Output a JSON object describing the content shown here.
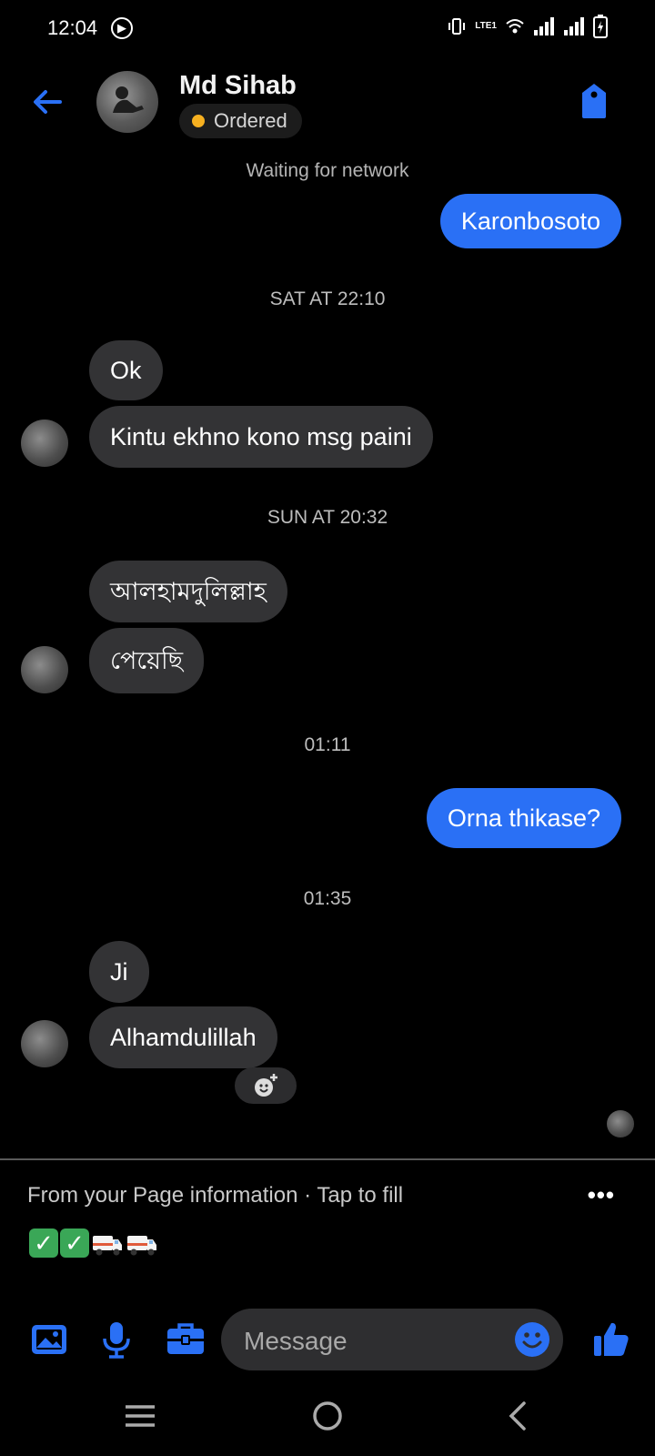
{
  "status_bar": {
    "time": "12:04",
    "network_label": "LTE1"
  },
  "header": {
    "contact_name": "Md Sihab",
    "label_status": "Ordered",
    "label_color": "#f6b020"
  },
  "network_notice": "Waiting for network",
  "messages": [
    {
      "kind": "out",
      "text": "Karonbosoto"
    },
    {
      "kind": "stamp",
      "text": "SAT AT 22:10"
    },
    {
      "kind": "in",
      "text": "Ok"
    },
    {
      "kind": "in",
      "text": "Kintu ekhno kono msg paini"
    },
    {
      "kind": "stamp",
      "text": "SUN AT 20:32"
    },
    {
      "kind": "in",
      "text": "আলহামদুলিল্লাহ"
    },
    {
      "kind": "in",
      "text": "পেয়েছি"
    },
    {
      "kind": "stamp",
      "text": "01:11"
    },
    {
      "kind": "out",
      "text": "Orna thikase?"
    },
    {
      "kind": "stamp",
      "text": "01:35"
    },
    {
      "kind": "in",
      "text": "Ji"
    },
    {
      "kind": "in",
      "text": "Alhamdulillah"
    }
  ],
  "suggestion": {
    "text": "From your Page information · Tap to fill",
    "more": "•••"
  },
  "composer": {
    "placeholder": "Message"
  },
  "colors": {
    "accent": "#2a70f5",
    "incoming": "#333335",
    "background": "#000000"
  },
  "icons": [
    "back-arrow-icon",
    "tag-icon",
    "image-icon",
    "mic-icon",
    "briefcase-icon",
    "emoji-icon",
    "thumbs-up-icon",
    "add-reaction-icon"
  ]
}
